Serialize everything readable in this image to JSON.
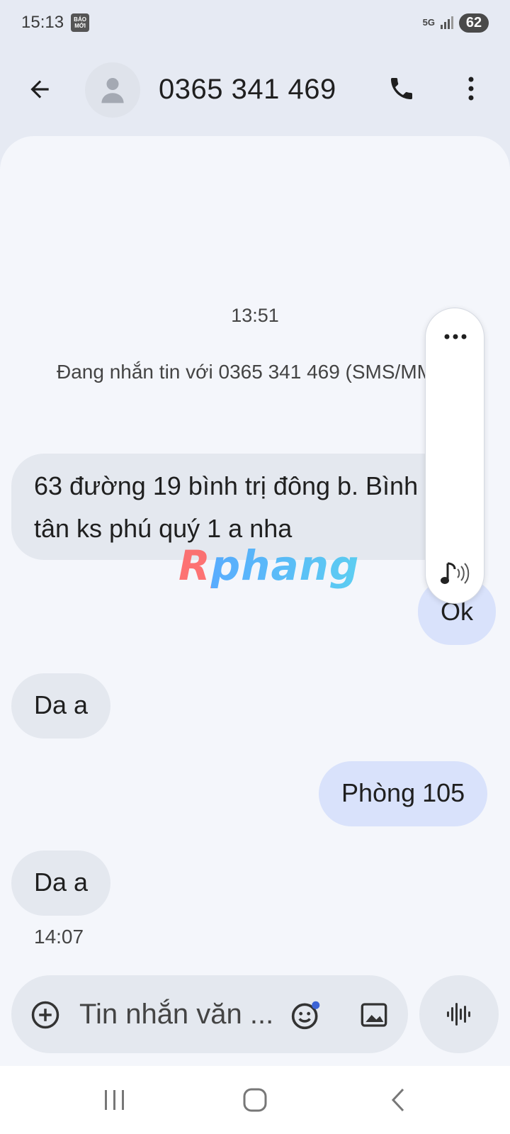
{
  "status_bar": {
    "time": "15:13",
    "news_badge_line1": "BÁO",
    "news_badge_line2": "MỚI",
    "network": "5G",
    "battery": "62"
  },
  "header": {
    "contact": "0365 341 469"
  },
  "conversation": {
    "date_time": "13:51",
    "info": "Đang nhắn tin với 0365 341 469 (SMS/MMS)",
    "messages": [
      {
        "direction": "incoming",
        "text": "63 đường 19 bình trị đông b. Bình tân ks phú quý 1 a nha"
      },
      {
        "direction": "outgoing",
        "text": "Ok"
      },
      {
        "direction": "incoming",
        "text": "Da a"
      },
      {
        "direction": "outgoing",
        "text": "Phòng 105"
      },
      {
        "direction": "incoming",
        "text": "Da a"
      }
    ],
    "last_time": "14:07"
  },
  "watermark": "Rphang",
  "composer": {
    "placeholder": "Tin nhắn văn ..."
  },
  "icons": {
    "back": "arrow-left-icon",
    "avatar": "person-icon",
    "call": "phone-icon",
    "more": "more-vertical-icon",
    "toolbar_more": "more-horizontal-icon",
    "toolbar_sound": "music-sound-icon",
    "add": "add-circle-icon",
    "emoji": "emoji-icon",
    "gallery": "image-icon",
    "voice": "waveform-icon"
  },
  "colors": {
    "incoming_bubble": "#e4e8ef",
    "outgoing_bubble": "#d9e2fb",
    "background": "#f4f6fb"
  }
}
